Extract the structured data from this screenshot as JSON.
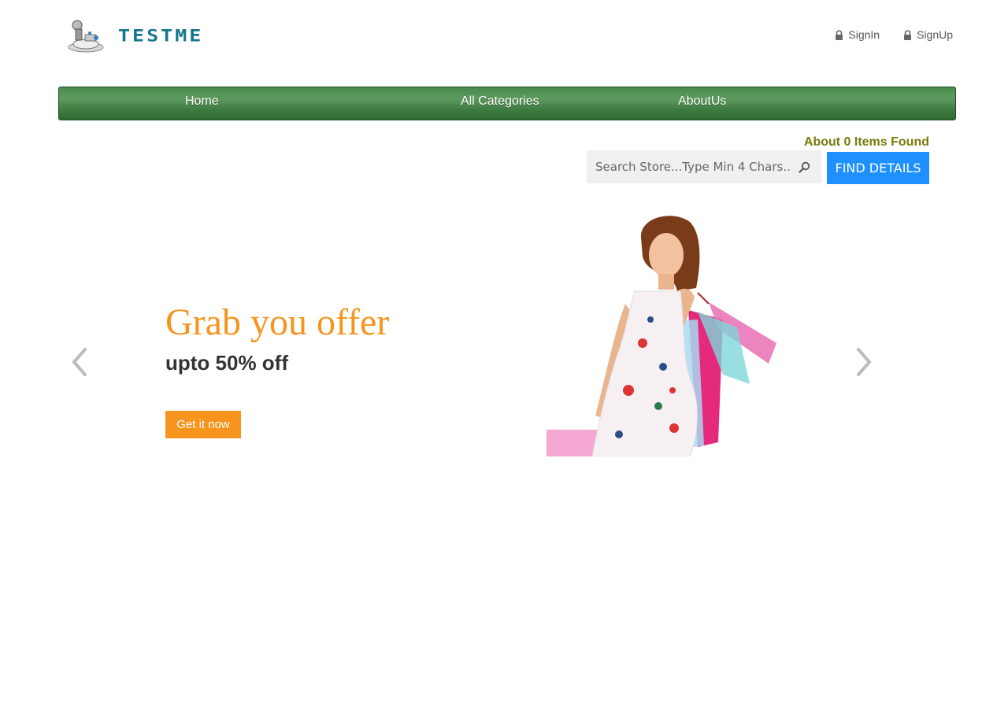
{
  "brand": {
    "name": "TESTME",
    "color": "#16768c"
  },
  "auth": {
    "signin": "SignIn",
    "signup": "SignUp"
  },
  "nav": {
    "items": [
      "Home",
      "All Categories",
      "AboutUs"
    ]
  },
  "search": {
    "results": "About 0 Items Found",
    "placeholder": "Search Store...Type Min 4 Chars...",
    "button": "FIND DETAILS"
  },
  "carousel": {
    "headline": "Grab you offer",
    "subline": "upto 50% off",
    "cta": "Get it now",
    "accent": "#f7941d"
  },
  "colors": {
    "nav": "#4a8a4c",
    "findButton": "#1e90ff"
  }
}
